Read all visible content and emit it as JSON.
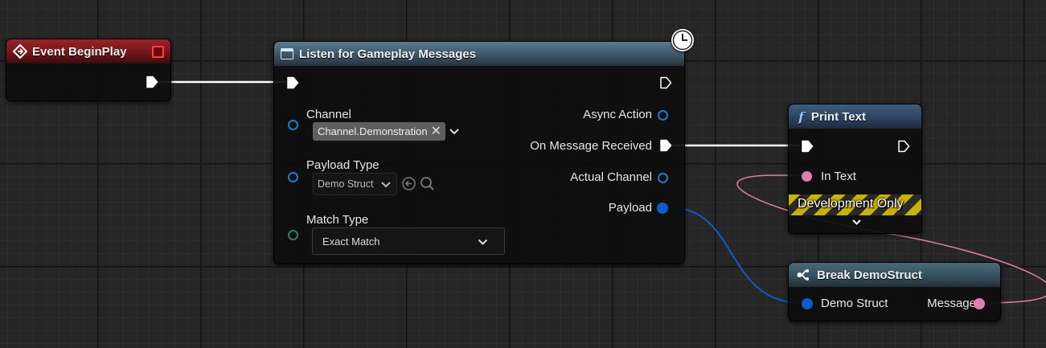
{
  "nodes": {
    "event_begin_play": {
      "title": "Event BeginPlay"
    },
    "listen": {
      "title": "Listen for Gameplay Messages",
      "channel_label": "Channel",
      "channel_value": "Channel.Demonstration",
      "payload_type_label": "Payload Type",
      "payload_type_value": "Demo Struct",
      "match_type_label": "Match Type",
      "match_type_value": "Exact Match",
      "async_action_label": "Async Action",
      "on_message_received_label": "On Message Received",
      "actual_channel_label": "Actual Channel",
      "payload_label": "Payload"
    },
    "print_text": {
      "title": "Print Text",
      "in_text_label": "In Text",
      "dev_only_label": "Development Only"
    },
    "break_struct": {
      "title": "Break DemoStruct",
      "demo_struct_label": "Demo Struct",
      "message_label": "Message"
    }
  },
  "colors": {
    "exec_wire": "#ffffff",
    "struct_pin": "#0d5ccc",
    "text_pin": "#e07fae",
    "name_pin": "#2e7d6a",
    "object_pin": "#1e7bd0",
    "event_header": "#7a1a1d",
    "function_header": "#2c4460"
  },
  "icons": {
    "event": "event-diamond-icon",
    "async_node": "async-node-icon",
    "latent": "clock-icon",
    "function": "function-f-icon",
    "break": "break-struct-icon"
  }
}
